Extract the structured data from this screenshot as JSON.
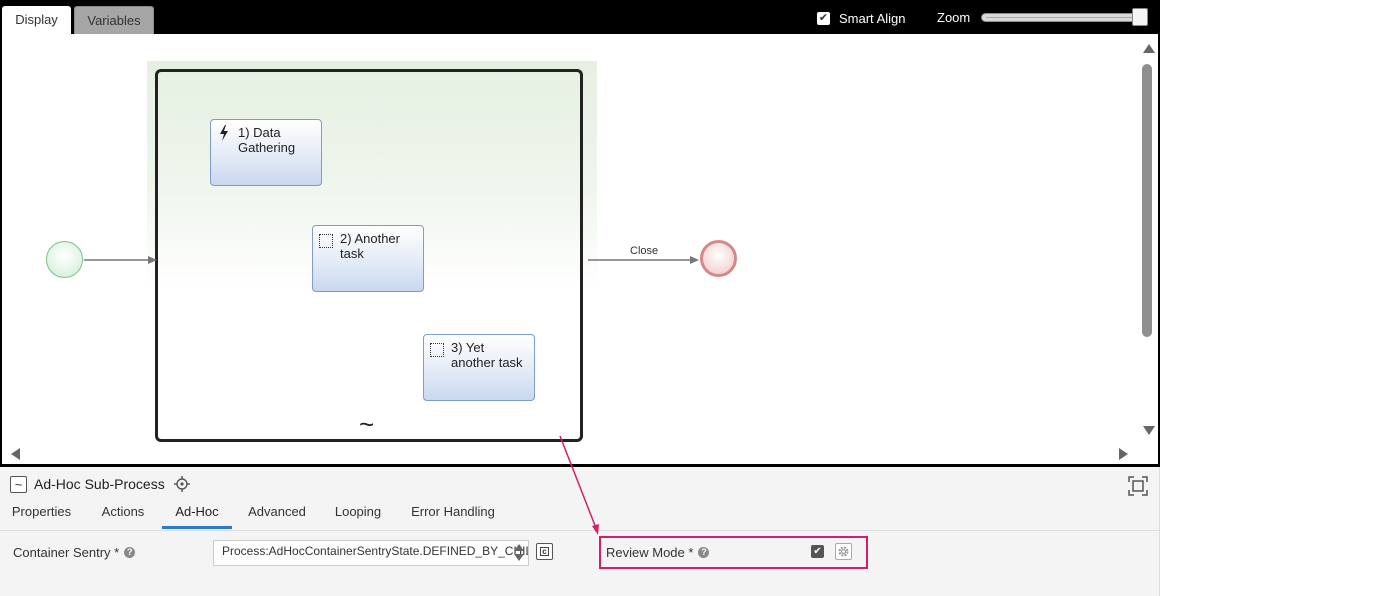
{
  "editor": {
    "tabs": [
      {
        "label": "Display",
        "active": true
      },
      {
        "label": "Variables",
        "active": false
      }
    ],
    "smart_align": {
      "label": "Smart Align",
      "checked": true
    },
    "zoom": {
      "label": "Zoom",
      "value": 1.0
    }
  },
  "diagram": {
    "tasks": [
      {
        "label": "1) Data Gathering",
        "icon": "lightning-icon"
      },
      {
        "label": "2) Another task",
        "icon": "manual-task-icon"
      },
      {
        "label": "3) Yet another task",
        "icon": "manual-task-icon"
      }
    ],
    "flow_label": "Close",
    "adhoc_marker": "~"
  },
  "panel": {
    "type_icon": "~",
    "title": "Ad-Hoc Sub-Process",
    "tabs": [
      {
        "label": "Properties"
      },
      {
        "label": "Actions"
      },
      {
        "label": "Ad-Hoc",
        "active": true
      },
      {
        "label": "Advanced"
      },
      {
        "label": "Looping"
      },
      {
        "label": "Error Handling"
      }
    ],
    "container_sentry": {
      "label": "Container Sentry *",
      "help": "?",
      "value": "Process:AdHocContainerSentryState.DEFINED_BY_CHILDREN()"
    },
    "review_mode": {
      "label": "Review Mode *",
      "help": "?",
      "checked": true
    }
  },
  "colors": {
    "highlight": "#d0206a",
    "active_tab_underline": "#2a7bd0",
    "task_border": "#7d9dcc",
    "start_event": "#7cc28c",
    "end_event": "#d48a8a"
  }
}
